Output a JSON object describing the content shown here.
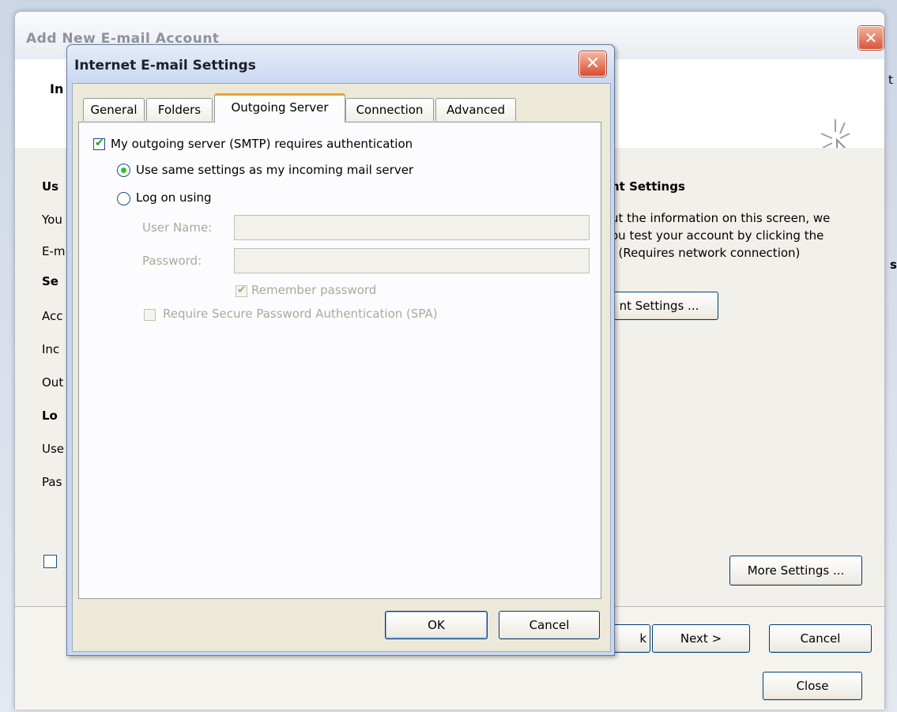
{
  "background_window": {
    "title": "Add New E-mail Account",
    "close_glyph": "✕",
    "header_title_fragment": "In",
    "left_labels": [
      "Us",
      "You",
      "E-m",
      "Se",
      "Acc",
      "Inc",
      "Out",
      "Lo",
      "Use",
      "Pas"
    ],
    "right_heading": "nt Settings",
    "right_para": [
      "ut the information on this screen, we",
      "ou test your account by clicking the",
      ". (Requires network connection)"
    ],
    "test_button_fragment": "nt Settings ...",
    "more_settings_label": "More Settings ...",
    "back_fragment": "k",
    "next_label": "Next >",
    "cancel_label": "Cancel",
    "close_label": "Close",
    "edge_fragment_t": "t",
    "edge_fragment_s": "s"
  },
  "dialog": {
    "title": "Internet E-mail Settings",
    "close_glyph": "✕",
    "tabs": [
      "General",
      "Folders",
      "Outgoing Server",
      "Connection",
      "Advanced"
    ],
    "active_tab": "Outgoing Server",
    "smtp_auth_label": "My outgoing server (SMTP) requires authentication",
    "smtp_auth_checked": true,
    "use_same_label": "Use same settings as my incoming mail server",
    "log_on_label": "Log on using",
    "selected_option": "use_same",
    "user_name_label": "User Name:",
    "user_name_value": "",
    "password_label": "Password:",
    "password_value": "",
    "remember_label": "Remember password",
    "remember_checked": true,
    "spa_label": "Require Secure Password Authentication (SPA)",
    "spa_checked": false,
    "ok_label": "OK",
    "cancel_label": "Cancel"
  },
  "icons": {
    "check": "✔",
    "pointer": "cursor-click-icon"
  },
  "colors": {
    "check_green": "#21a121",
    "radio_dot": "#2fbf2f",
    "active_tab_accent": "#f0a030",
    "close_red": "#d84c30"
  }
}
